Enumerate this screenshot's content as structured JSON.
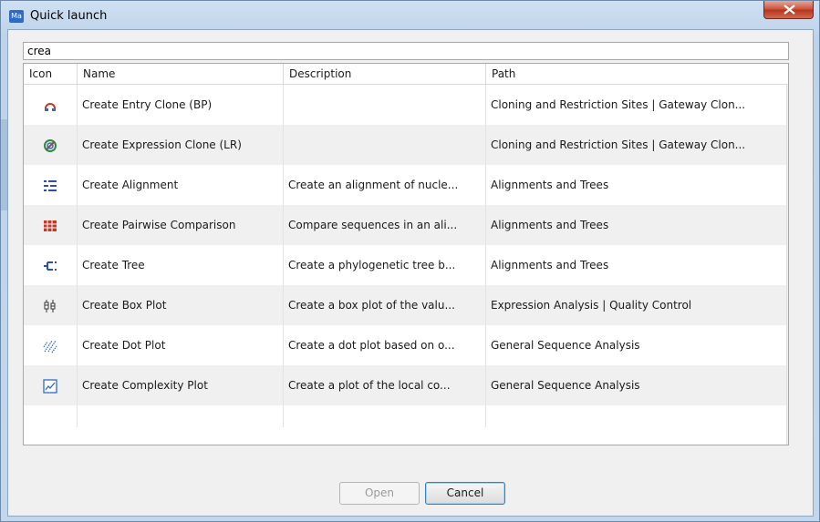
{
  "window": {
    "app_icon_text": "Ma",
    "title": "Quick launch",
    "close_icon": "close-icon"
  },
  "search": {
    "value": "crea"
  },
  "table": {
    "headers": {
      "icon": "Icon",
      "name": "Name",
      "description": "Description",
      "path": "Path"
    },
    "rows": [
      {
        "icon": "entry-clone-icon",
        "name": "Create Entry Clone (BP)",
        "description": "",
        "path": "Cloning and Restriction Sites | Gateway Clon..."
      },
      {
        "icon": "expression-clone-icon",
        "name": "Create Expression Clone (LR)",
        "description": "",
        "path": "Cloning and Restriction Sites | Gateway Clon..."
      },
      {
        "icon": "alignment-icon",
        "name": "Create Alignment",
        "description": "Create an alignment of nucle...",
        "path": "Alignments and Trees"
      },
      {
        "icon": "pairwise-comparison-icon",
        "name": "Create Pairwise Comparison",
        "description": "Compare sequences in an ali...",
        "path": "Alignments and Trees"
      },
      {
        "icon": "tree-icon",
        "name": "Create Tree",
        "description": "Create a phylogenetic tree b...",
        "path": "Alignments and Trees"
      },
      {
        "icon": "box-plot-icon",
        "name": "Create Box Plot",
        "description": "Create a box plot of the valu...",
        "path": "Expression Analysis | Quality Control"
      },
      {
        "icon": "dot-plot-icon",
        "name": "Create Dot Plot",
        "description": "Create a dot plot based on o...",
        "path": "General Sequence Analysis"
      },
      {
        "icon": "complexity-plot-icon",
        "name": "Create Complexity Plot",
        "description": "Create a plot of the local co...",
        "path": "General Sequence Analysis"
      }
    ]
  },
  "buttons": {
    "open": "Open",
    "cancel": "Cancel"
  }
}
